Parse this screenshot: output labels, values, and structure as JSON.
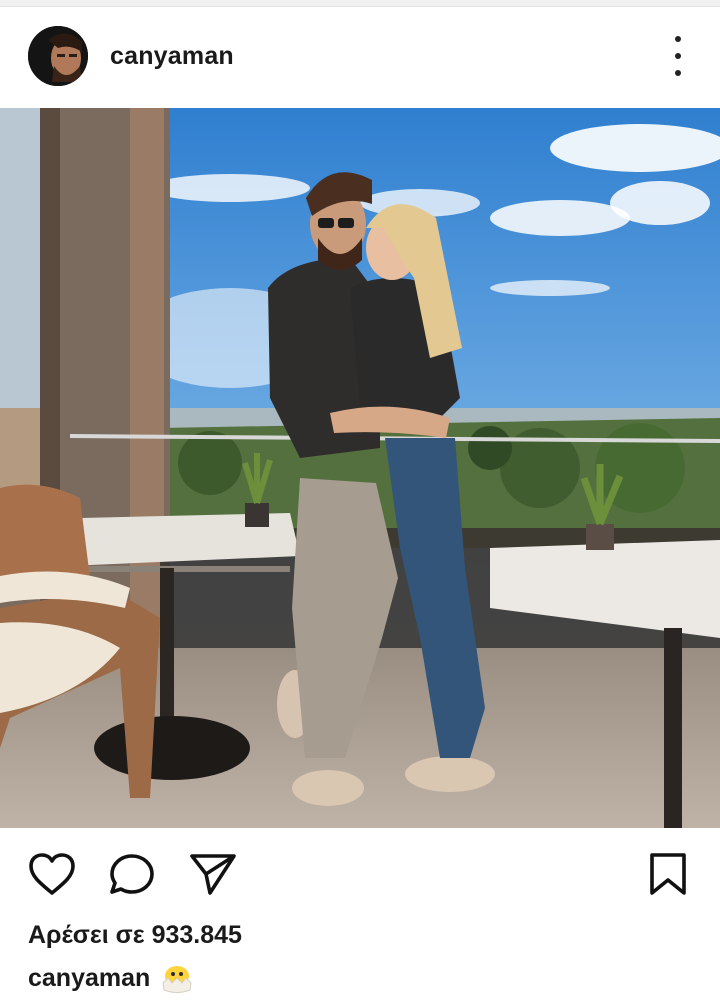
{
  "header": {
    "username": "canyaman"
  },
  "post": {
    "likes_text": "Αρέσει σε 933.845",
    "caption_username": "canyaman",
    "caption_emoji": "hatching-chick-emoji"
  },
  "icons": {
    "like": "heart-icon",
    "comment": "comment-icon",
    "share": "send-icon",
    "save": "bookmark-icon",
    "more": "more-vertical-icon"
  },
  "colors": {
    "text": "#1a1a1a",
    "sky": "#3f8fd8",
    "background": "#ffffff"
  }
}
